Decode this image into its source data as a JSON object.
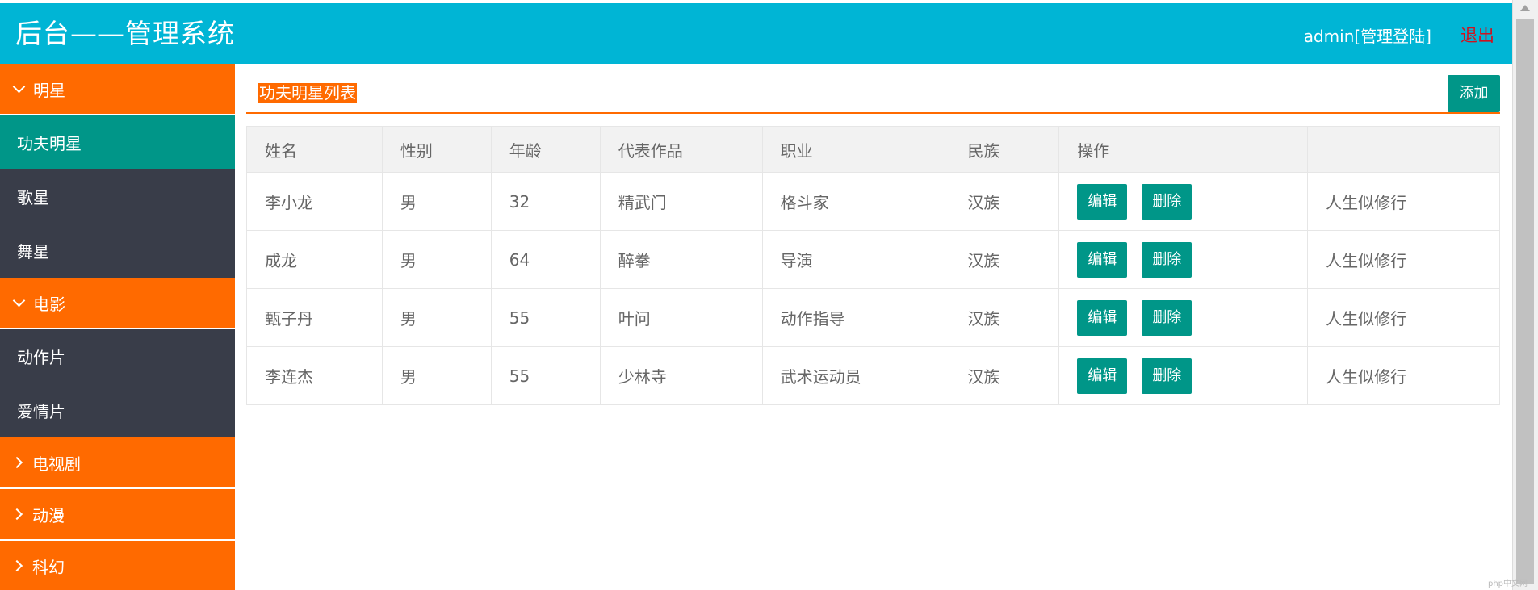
{
  "header": {
    "title": "后台——管理系统",
    "user": "admin[管理登陆]",
    "logout": "退出"
  },
  "sidebar": {
    "groups": [
      {
        "label": "明星",
        "expanded": true,
        "items": [
          {
            "label": "功夫明星",
            "active": true
          },
          {
            "label": "歌星",
            "active": false
          },
          {
            "label": "舞星",
            "active": false
          }
        ]
      },
      {
        "label": "电影",
        "expanded": true,
        "items": [
          {
            "label": "动作片",
            "active": false
          },
          {
            "label": "爱情片",
            "active": false
          }
        ]
      },
      {
        "label": "电视剧",
        "expanded": false
      },
      {
        "label": "动漫",
        "expanded": false
      },
      {
        "label": "科幻",
        "expanded": false
      }
    ]
  },
  "main": {
    "list_title": "功夫明星列表",
    "add_label": "添加",
    "table": {
      "columns": [
        "姓名",
        "性别",
        "年龄",
        "代表作品",
        "职业",
        "民族",
        "操作",
        ""
      ],
      "rows": [
        {
          "name": "李小龙",
          "gender": "男",
          "age": "32",
          "work": "精武门",
          "job": "格斗家",
          "ethnicity": "汉族",
          "edit": "编辑",
          "delete": "删除",
          "motto": "人生似修行"
        },
        {
          "name": "成龙",
          "gender": "男",
          "age": "64",
          "work": "醉拳",
          "job": "导演",
          "ethnicity": "汉族",
          "edit": "编辑",
          "delete": "删除",
          "motto": "人生似修行"
        },
        {
          "name": "甄子丹",
          "gender": "男",
          "age": "55",
          "work": "叶问",
          "job": "动作指导",
          "ethnicity": "汉族",
          "edit": "编辑",
          "delete": "删除",
          "motto": "人生似修行"
        },
        {
          "name": "李连杰",
          "gender": "男",
          "age": "55",
          "work": "少林寺",
          "job": "武术运动员",
          "ethnicity": "汉族",
          "edit": "编辑",
          "delete": "删除",
          "motto": "人生似修行"
        }
      ]
    }
  },
  "watermark": "php中文网",
  "colors": {
    "header": "#00b5d5",
    "menu_group": "#ff6a00",
    "submenu": "#393d49",
    "active": "#009688",
    "logout": "#d0121f"
  }
}
